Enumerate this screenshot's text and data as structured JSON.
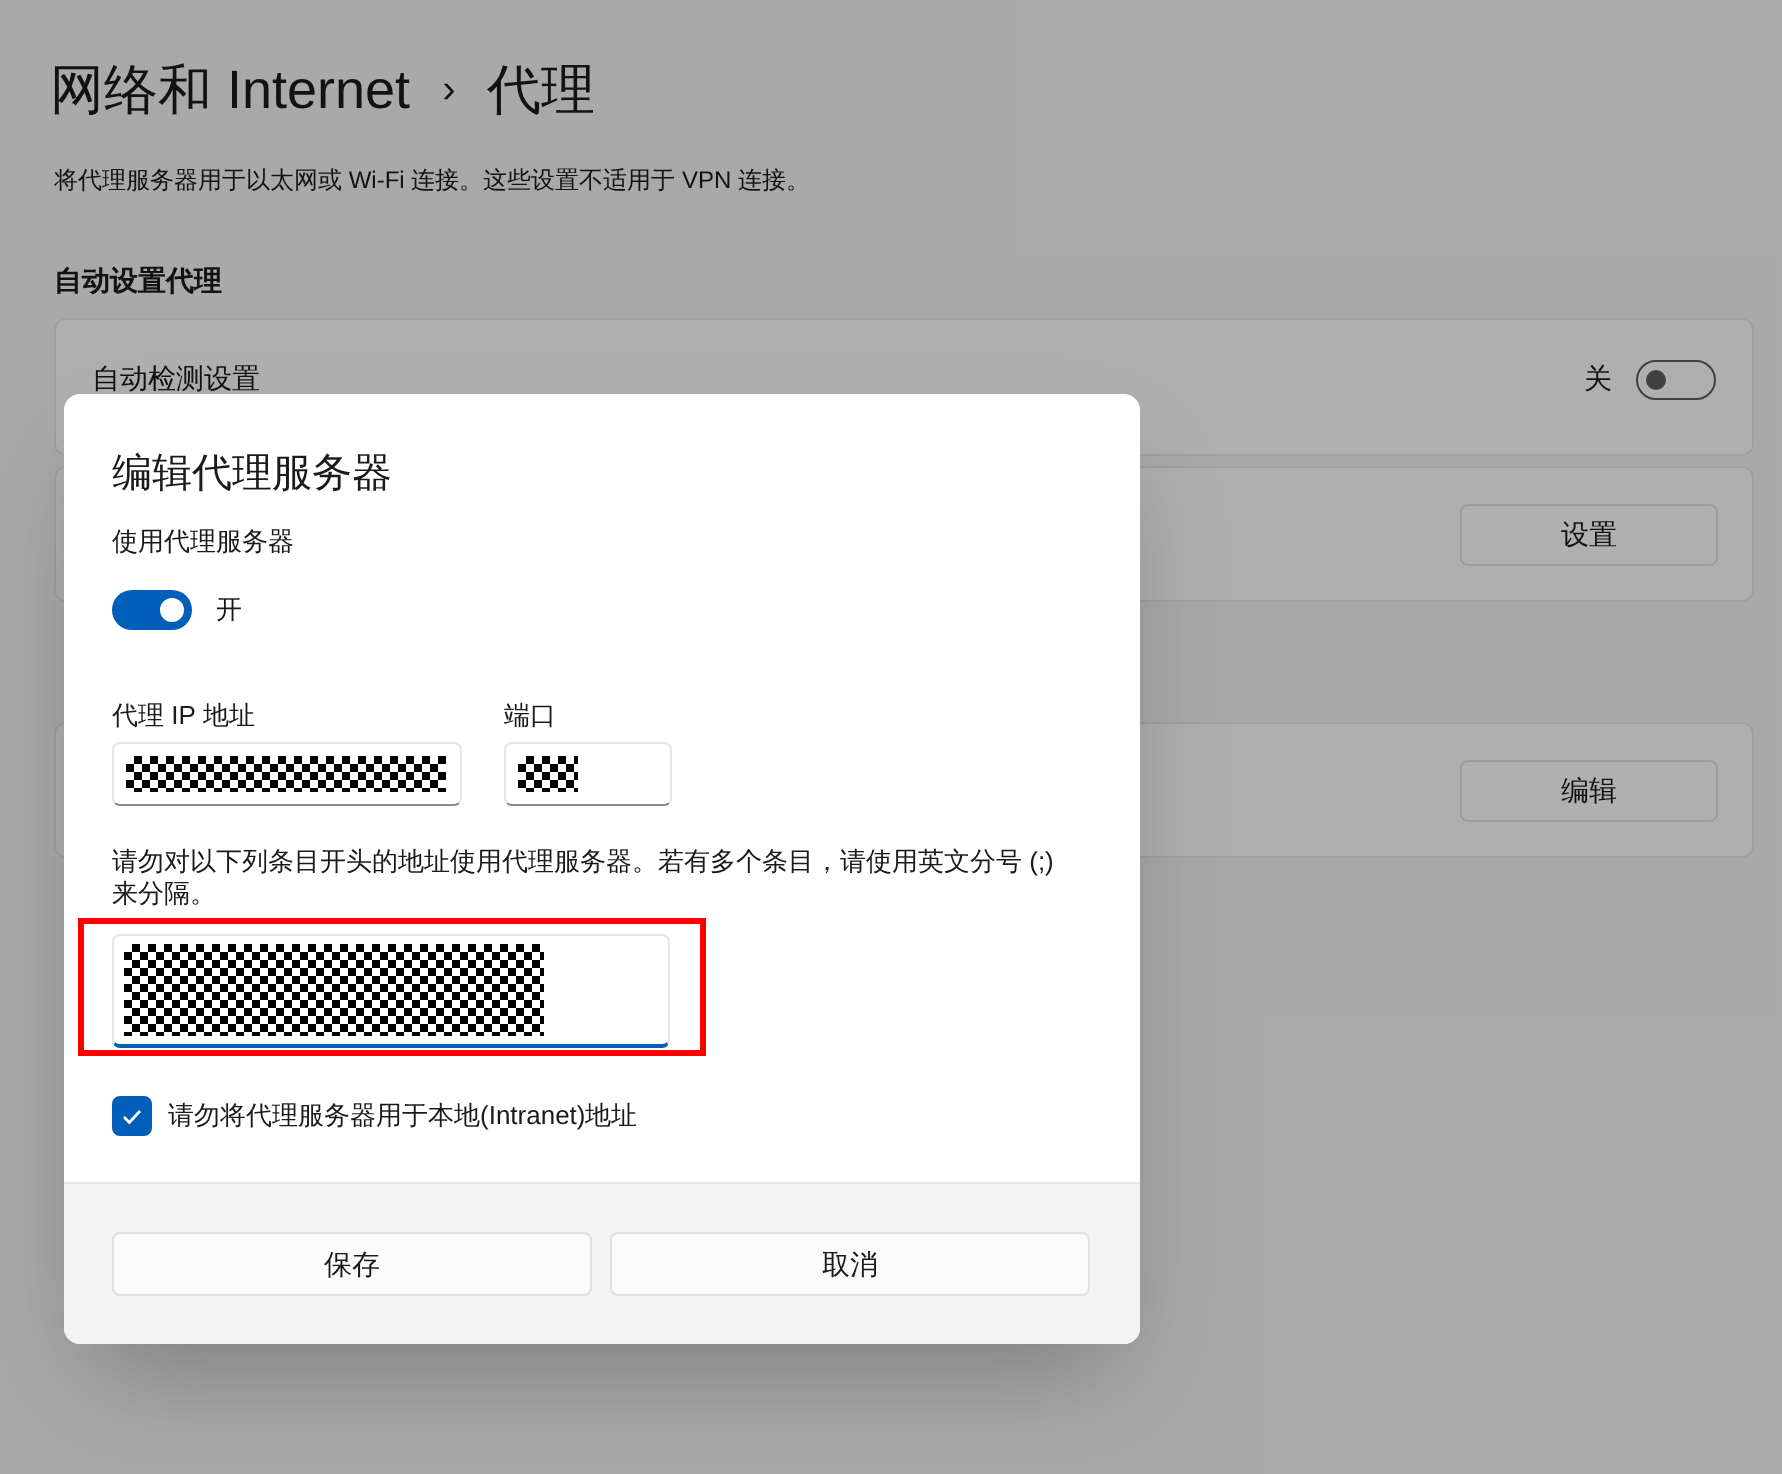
{
  "page": {
    "breadcrumb_parent": "网络和 Internet",
    "separator": "›",
    "title": "代理",
    "description": "将代理服务器用于以太网或 Wi-Fi 连接。这些设置不适用于 VPN 连接。",
    "section_title": "自动设置代理",
    "auto_detect": {
      "label": "自动检测设置",
      "state_text": "关",
      "on": false
    },
    "setup_script": {
      "button": "设置"
    },
    "manual_proxy": {
      "button": "编辑"
    }
  },
  "dialog": {
    "title": "编辑代理服务器",
    "use_proxy": {
      "label": "使用代理服务器",
      "on": true,
      "state_text": "开"
    },
    "ip_field": {
      "label": "代理 IP 地址",
      "redacted": true
    },
    "port_field": {
      "label": "端口",
      "redacted": true
    },
    "exceptions": {
      "label": "请勿对以下列条目开头的地址使用代理服务器。若有多个条目，请使用英文分号 (;) 来分隔。",
      "redacted": true,
      "highlighted": true
    },
    "local_bypass": {
      "label": "请勿将代理服务器用于本地(Intranet)地址",
      "checked": true
    },
    "buttons": [
      "保存",
      "取消"
    ]
  }
}
